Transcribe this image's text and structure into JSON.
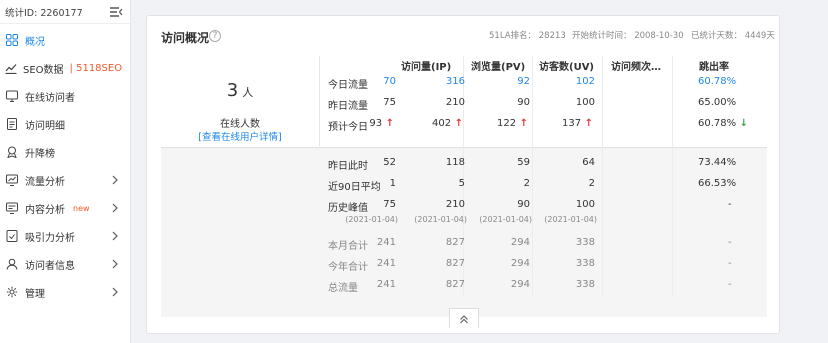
{
  "sidebar": {
    "stat_id": "统计ID: 2260177",
    "items": [
      {
        "label": "概况",
        "icon": "grid-icon",
        "active": true
      },
      {
        "label": "SEO数据",
        "icon": "trend-chart-icon",
        "extra": "| 5118SEO"
      },
      {
        "label": "在线访问者",
        "icon": "online-visitors-icon"
      },
      {
        "label": "访问明细",
        "icon": "document-icon"
      },
      {
        "label": "升降榜",
        "icon": "ranking-icon"
      },
      {
        "label": "流量分析",
        "icon": "traffic-icon",
        "has_arrow": true
      },
      {
        "label": "内容分析",
        "icon": "content-icon",
        "badge": "new",
        "has_arrow": true
      },
      {
        "label": "吸引力分析",
        "icon": "attraction-icon",
        "has_arrow": true
      },
      {
        "label": "访问者信息",
        "icon": "user-info-icon",
        "has_arrow": true
      },
      {
        "label": "管理",
        "icon": "gear-icon",
        "has_arrow": true
      }
    ]
  },
  "overview": {
    "title": "访问概况",
    "rank": "51LA排名： 28213",
    "start_time": "开始统计时间： 2008-10-30",
    "days": "已统计天数： 4449天",
    "online_count": "3",
    "online_unit": "人",
    "online_label": "在线人数",
    "online_link": "[查看在线用户详情]",
    "headers": [
      "访问量(IP)",
      "浏览量(PV)",
      "访客数(UV)",
      "访问频次…",
      "跳出率"
    ],
    "rows": [
      {
        "label": "今日流量",
        "cells": [
          "70",
          "316",
          "92",
          "102",
          "60.78%"
        ],
        "style": "link"
      },
      {
        "label": "昨日流量",
        "cells": [
          "75",
          "210",
          "90",
          "100",
          "65.00%"
        ]
      },
      {
        "label": "预计今日",
        "cells": [
          "93",
          "402",
          "122",
          "137",
          "60.78%"
        ],
        "trend": [
          "up",
          "up",
          "up",
          "up",
          "down"
        ]
      },
      {
        "label": "昨日此时",
        "cells": [
          "52",
          "118",
          "59",
          "64",
          "73.44%"
        ]
      },
      {
        "label": "近90日平均",
        "cells": [
          "1",
          "5",
          "2",
          "2",
          "66.53%"
        ]
      },
      {
        "label": "历史峰值",
        "cells": [
          "75",
          "210",
          "90",
          "100",
          "-"
        ],
        "dates": [
          "(2021-01-04)",
          "(2021-01-04)",
          "(2021-01-04)",
          "(2021-01-04)"
        ]
      },
      {
        "label": "本月合计",
        "cells": [
          "241",
          "827",
          "294",
          "338",
          "-"
        ],
        "style": "muted"
      },
      {
        "label": "今年合计",
        "cells": [
          "241",
          "827",
          "294",
          "338",
          "-"
        ],
        "style": "muted"
      },
      {
        "label": "总流量",
        "cells": [
          "241",
          "827",
          "294",
          "338",
          "-"
        ],
        "style": "muted"
      }
    ]
  },
  "colors": {
    "accent": "#1e88e5",
    "up_arrow": "#e53935",
    "down_arrow": "#43a047",
    "promo": "#f0592a"
  }
}
